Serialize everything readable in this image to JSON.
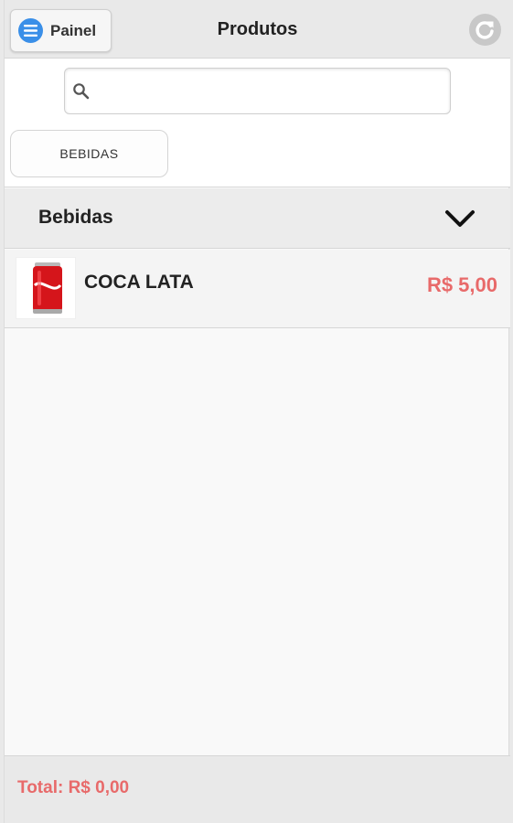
{
  "header": {
    "panel_label": "Painel",
    "title": "Produtos",
    "menu_icon": "menu-icon",
    "refresh_icon": "refresh-icon"
  },
  "search": {
    "value": "",
    "placeholder": "",
    "icon": "search-icon"
  },
  "category_filter": {
    "label": "BEBIDAS"
  },
  "section": {
    "title": "Bebidas",
    "expand_icon": "chevron-down-icon",
    "expanded": true,
    "items": [
      {
        "name": "COCA LATA",
        "price": "R$ 5,00",
        "image": "coca-cola-can-image"
      }
    ]
  },
  "footer": {
    "total": "Total: R$ 0,00"
  },
  "colors": {
    "accent_blue": "#3a8fe8",
    "price_red": "#e86a6a",
    "header_bg": "#e9e9e9"
  }
}
